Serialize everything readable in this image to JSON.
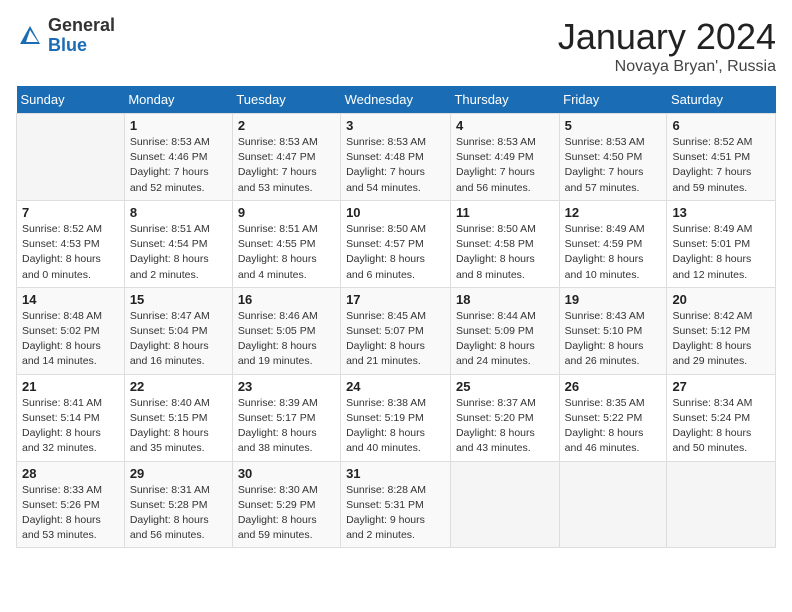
{
  "header": {
    "logo_line1": "General",
    "logo_line2": "Blue",
    "title": "January 2024",
    "subtitle": "Novaya Bryan', Russia"
  },
  "weekdays": [
    "Sunday",
    "Monday",
    "Tuesday",
    "Wednesday",
    "Thursday",
    "Friday",
    "Saturday"
  ],
  "weeks": [
    [
      {
        "day": "",
        "info": ""
      },
      {
        "day": "1",
        "info": "Sunrise: 8:53 AM\nSunset: 4:46 PM\nDaylight: 7 hours\nand 52 minutes."
      },
      {
        "day": "2",
        "info": "Sunrise: 8:53 AM\nSunset: 4:47 PM\nDaylight: 7 hours\nand 53 minutes."
      },
      {
        "day": "3",
        "info": "Sunrise: 8:53 AM\nSunset: 4:48 PM\nDaylight: 7 hours\nand 54 minutes."
      },
      {
        "day": "4",
        "info": "Sunrise: 8:53 AM\nSunset: 4:49 PM\nDaylight: 7 hours\nand 56 minutes."
      },
      {
        "day": "5",
        "info": "Sunrise: 8:53 AM\nSunset: 4:50 PM\nDaylight: 7 hours\nand 57 minutes."
      },
      {
        "day": "6",
        "info": "Sunrise: 8:52 AM\nSunset: 4:51 PM\nDaylight: 7 hours\nand 59 minutes."
      }
    ],
    [
      {
        "day": "7",
        "info": "Sunrise: 8:52 AM\nSunset: 4:53 PM\nDaylight: 8 hours\nand 0 minutes."
      },
      {
        "day": "8",
        "info": "Sunrise: 8:51 AM\nSunset: 4:54 PM\nDaylight: 8 hours\nand 2 minutes."
      },
      {
        "day": "9",
        "info": "Sunrise: 8:51 AM\nSunset: 4:55 PM\nDaylight: 8 hours\nand 4 minutes."
      },
      {
        "day": "10",
        "info": "Sunrise: 8:50 AM\nSunset: 4:57 PM\nDaylight: 8 hours\nand 6 minutes."
      },
      {
        "day": "11",
        "info": "Sunrise: 8:50 AM\nSunset: 4:58 PM\nDaylight: 8 hours\nand 8 minutes."
      },
      {
        "day": "12",
        "info": "Sunrise: 8:49 AM\nSunset: 4:59 PM\nDaylight: 8 hours\nand 10 minutes."
      },
      {
        "day": "13",
        "info": "Sunrise: 8:49 AM\nSunset: 5:01 PM\nDaylight: 8 hours\nand 12 minutes."
      }
    ],
    [
      {
        "day": "14",
        "info": "Sunrise: 8:48 AM\nSunset: 5:02 PM\nDaylight: 8 hours\nand 14 minutes."
      },
      {
        "day": "15",
        "info": "Sunrise: 8:47 AM\nSunset: 5:04 PM\nDaylight: 8 hours\nand 16 minutes."
      },
      {
        "day": "16",
        "info": "Sunrise: 8:46 AM\nSunset: 5:05 PM\nDaylight: 8 hours\nand 19 minutes."
      },
      {
        "day": "17",
        "info": "Sunrise: 8:45 AM\nSunset: 5:07 PM\nDaylight: 8 hours\nand 21 minutes."
      },
      {
        "day": "18",
        "info": "Sunrise: 8:44 AM\nSunset: 5:09 PM\nDaylight: 8 hours\nand 24 minutes."
      },
      {
        "day": "19",
        "info": "Sunrise: 8:43 AM\nSunset: 5:10 PM\nDaylight: 8 hours\nand 26 minutes."
      },
      {
        "day": "20",
        "info": "Sunrise: 8:42 AM\nSunset: 5:12 PM\nDaylight: 8 hours\nand 29 minutes."
      }
    ],
    [
      {
        "day": "21",
        "info": "Sunrise: 8:41 AM\nSunset: 5:14 PM\nDaylight: 8 hours\nand 32 minutes."
      },
      {
        "day": "22",
        "info": "Sunrise: 8:40 AM\nSunset: 5:15 PM\nDaylight: 8 hours\nand 35 minutes."
      },
      {
        "day": "23",
        "info": "Sunrise: 8:39 AM\nSunset: 5:17 PM\nDaylight: 8 hours\nand 38 minutes."
      },
      {
        "day": "24",
        "info": "Sunrise: 8:38 AM\nSunset: 5:19 PM\nDaylight: 8 hours\nand 40 minutes."
      },
      {
        "day": "25",
        "info": "Sunrise: 8:37 AM\nSunset: 5:20 PM\nDaylight: 8 hours\nand 43 minutes."
      },
      {
        "day": "26",
        "info": "Sunrise: 8:35 AM\nSunset: 5:22 PM\nDaylight: 8 hours\nand 46 minutes."
      },
      {
        "day": "27",
        "info": "Sunrise: 8:34 AM\nSunset: 5:24 PM\nDaylight: 8 hours\nand 50 minutes."
      }
    ],
    [
      {
        "day": "28",
        "info": "Sunrise: 8:33 AM\nSunset: 5:26 PM\nDaylight: 8 hours\nand 53 minutes."
      },
      {
        "day": "29",
        "info": "Sunrise: 8:31 AM\nSunset: 5:28 PM\nDaylight: 8 hours\nand 56 minutes."
      },
      {
        "day": "30",
        "info": "Sunrise: 8:30 AM\nSunset: 5:29 PM\nDaylight: 8 hours\nand 59 minutes."
      },
      {
        "day": "31",
        "info": "Sunrise: 8:28 AM\nSunset: 5:31 PM\nDaylight: 9 hours\nand 2 minutes."
      },
      {
        "day": "",
        "info": ""
      },
      {
        "day": "",
        "info": ""
      },
      {
        "day": "",
        "info": ""
      }
    ]
  ]
}
